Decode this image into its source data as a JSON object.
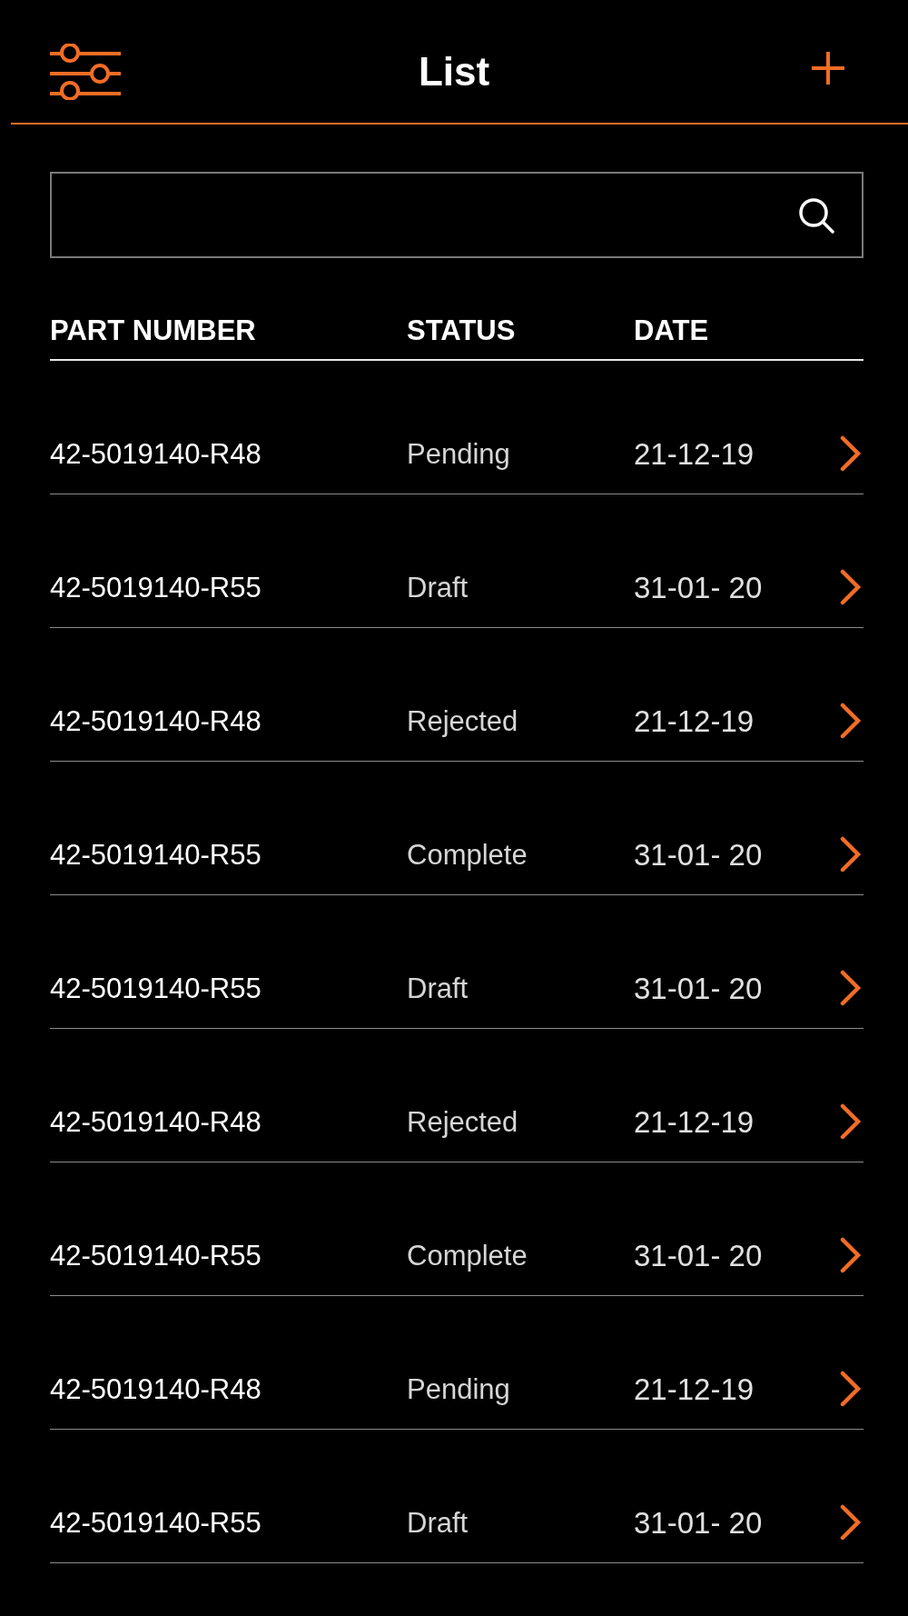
{
  "header": {
    "title": "List"
  },
  "table": {
    "columns": [
      "PART NUMBER",
      "STATUS",
      "DATE"
    ],
    "rows": [
      {
        "part_number": "42-5019140-R48",
        "status": "Pending",
        "date": "21-12-19"
      },
      {
        "part_number": "42-5019140-R55",
        "status": "Draft",
        "date": "31-01- 20"
      },
      {
        "part_number": "42-5019140-R48",
        "status": "Rejected",
        "date": "21-12-19"
      },
      {
        "part_number": "42-5019140-R55",
        "status": "Complete",
        "date": "31-01- 20"
      },
      {
        "part_number": "42-5019140-R55",
        "status": "Draft",
        "date": "31-01- 20"
      },
      {
        "part_number": "42-5019140-R48",
        "status": "Rejected",
        "date": "21-12-19"
      },
      {
        "part_number": "42-5019140-R55",
        "status": "Complete",
        "date": "31-01- 20"
      },
      {
        "part_number": "42-5019140-R48",
        "status": "Pending",
        "date": "21-12-19"
      },
      {
        "part_number": "42-5019140-R55",
        "status": "Draft",
        "date": "31-01- 20"
      }
    ]
  }
}
